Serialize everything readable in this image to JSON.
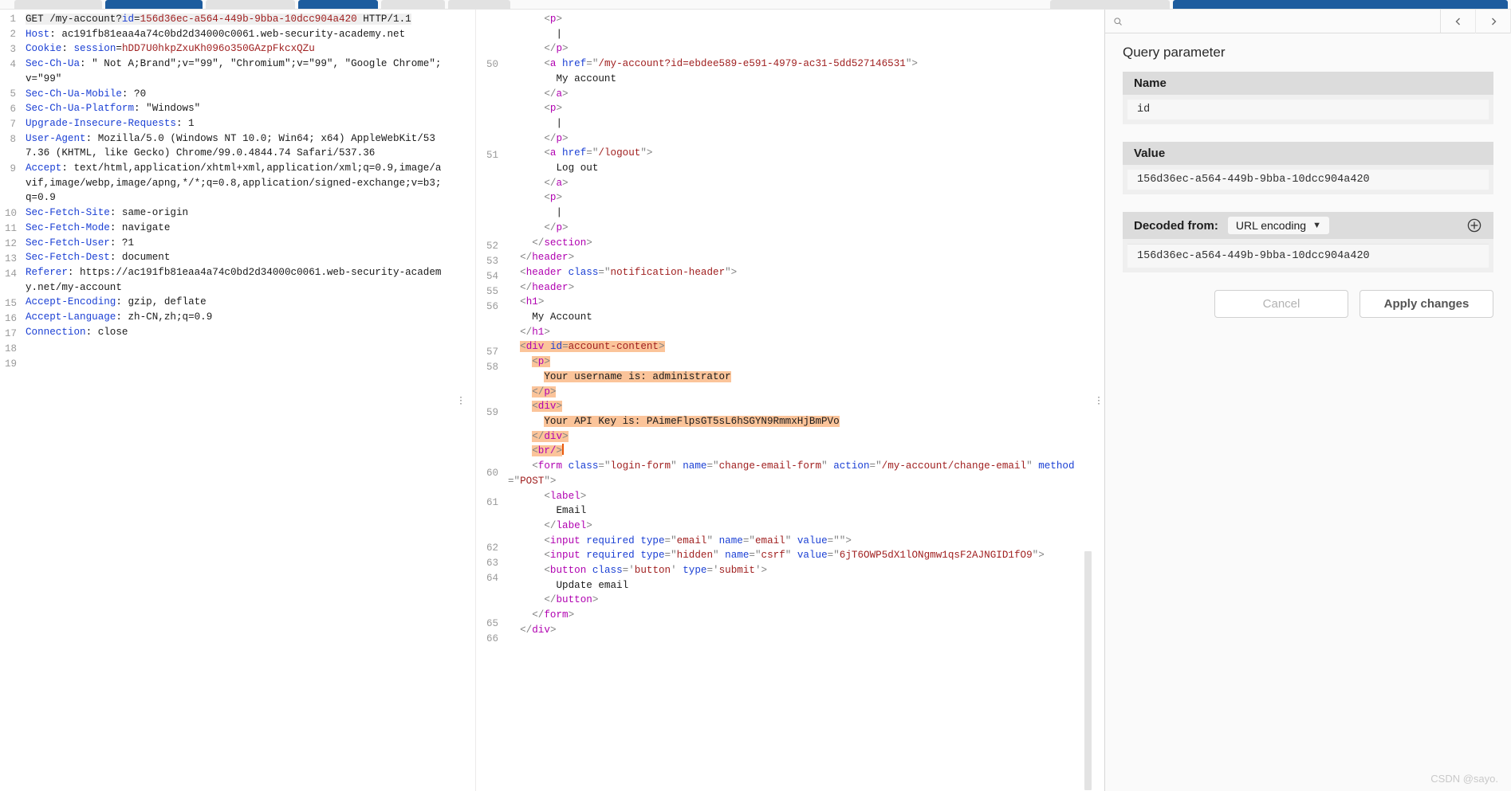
{
  "app": {
    "name": "burp-suite-repeater",
    "watermark": "CSDN @sayo."
  },
  "tabstrip": {
    "tabs": [
      {
        "name": "tab-dashboard",
        "selected": false
      },
      {
        "name": "tab-target",
        "selected": true
      },
      {
        "name": "tab-proxy",
        "selected": false
      },
      {
        "name": "tab-intruder",
        "selected": true
      },
      {
        "name": "tab-repeater",
        "selected": false
      },
      {
        "name": "tab-sequencer",
        "selected": false
      }
    ],
    "right_tabs": [
      {
        "name": "tab-request",
        "selected": false
      },
      {
        "name": "tab-response",
        "selected": true
      }
    ]
  },
  "request": {
    "pane_name": "request-editor",
    "lines": [
      {
        "n": "1",
        "html": "<span class='hl-soft'><span class='k-txt'>GET /my-account?</span><span class='k-attr'>id</span><span class='k-txt'>=</span><span class='k-red'>156d36ec-a564-449b-9bba-10dcc904a420</span><span class='k-txt'> HTTP/1.1</span></span>"
      },
      {
        "n": "2",
        "html": "<span class='k-hdr'>Host</span><span class='k-txt'>: ac191fb81eaa4a74c0bd2d34000c0061.web-security-academy.net</span>"
      },
      {
        "n": "3",
        "html": "<span class='k-hdr'>Cookie</span><span class='k-txt'>: </span><span class='k-hdr'>session</span><span class='k-txt'>=</span><span class='k-red'>hDD7U0hkpZxuKh096o350GAzpFkcxQZu</span>"
      },
      {
        "n": "4",
        "html": "<span class='k-hdr'>Sec-Ch-Ua</span><span class='k-txt'>: \" Not A;Brand\";v=\"99\", \"Chromium\";v=\"99\", \"Google Chrome\";v=\"99\"</span>"
      },
      {
        "n": "5",
        "html": "<span class='k-hdr'>Sec-Ch-Ua-Mobile</span><span class='k-txt'>: ?0</span>"
      },
      {
        "n": "6",
        "html": "<span class='k-hdr'>Sec-Ch-Ua-Platform</span><span class='k-txt'>: \"Windows\"</span>"
      },
      {
        "n": "7",
        "html": "<span class='k-hdr'>Upgrade-Insecure-Requests</span><span class='k-txt'>: 1</span>"
      },
      {
        "n": "8",
        "html": "<span class='k-hdr'>User-Agent</span><span class='k-txt'>: Mozilla/5.0 (Windows NT 10.0; Win64; x64) AppleWebKit/537.36 (KHTML, like Gecko) Chrome/99.0.4844.74 Safari/537.36</span>"
      },
      {
        "n": "9",
        "html": "<span class='k-hdr'>Accept</span><span class='k-txt'>: text/html,application/xhtml+xml,application/xml;q=0.9,image/avif,image/webp,image/apng,*/*;q=0.8,application/signed-exchange;v=b3;q=0.9</span>"
      },
      {
        "n": "10",
        "html": "<span class='k-hdr'>Sec-Fetch-Site</span><span class='k-txt'>: same-origin</span>"
      },
      {
        "n": "11",
        "html": "<span class='k-hdr'>Sec-Fetch-Mode</span><span class='k-txt'>: navigate</span>"
      },
      {
        "n": "12",
        "html": "<span class='k-hdr'>Sec-Fetch-User</span><span class='k-txt'>: ?1</span>"
      },
      {
        "n": "13",
        "html": "<span class='k-hdr'>Sec-Fetch-Dest</span><span class='k-txt'>: document</span>"
      },
      {
        "n": "14",
        "html": "<span class='k-hdr'>Referer</span><span class='k-txt'>: https://ac191fb81eaa4a74c0bd2d34000c0061.web-security-academy.net/my-account</span>"
      },
      {
        "n": "15",
        "html": "<span class='k-hdr'>Accept-Encoding</span><span class='k-txt'>: gzip, deflate</span>"
      },
      {
        "n": "16",
        "html": "<span class='k-hdr'>Accept-Language</span><span class='k-txt'>: zh-CN,zh;q=0.9</span>"
      },
      {
        "n": "17",
        "html": "<span class='k-hdr'>Connection</span><span class='k-txt'>: close</span>"
      },
      {
        "n": "18",
        "html": ""
      },
      {
        "n": "19",
        "html": ""
      }
    ]
  },
  "response": {
    "pane_name": "response-editor",
    "lines": [
      {
        "n": "",
        "html": "      <span class='k-punc'>&lt;</span><span class='k-tag'>p</span><span class='k-punc'>&gt;</span>"
      },
      {
        "n": "",
        "html": "        <span class='k-txt'>|</span>"
      },
      {
        "n": "",
        "html": "      <span class='k-punc'>&lt;/</span><span class='k-tag'>p</span><span class='k-punc'>&gt;</span>"
      },
      {
        "n": "50",
        "html": "      <span class='k-punc'>&lt;</span><span class='k-tag'>a</span> <span class='k-attr'>href</span><span class='k-punc'>=\"</span><span class='k-red'>/my-account?id=ebdee589-e591-4979-ac31-5dd527146531</span><span class='k-punc'>\"&gt;</span>"
      },
      {
        "n": "",
        "html": "        <span class='k-txt'>My account</span>"
      },
      {
        "n": "",
        "html": "      <span class='k-punc'>&lt;/</span><span class='k-tag'>a</span><span class='k-punc'>&gt;</span>"
      },
      {
        "n": "",
        "html": "      <span class='k-punc'>&lt;</span><span class='k-tag'>p</span><span class='k-punc'>&gt;</span>"
      },
      {
        "n": "",
        "html": "        <span class='k-txt'>|</span>"
      },
      {
        "n": "",
        "html": "      <span class='k-punc'>&lt;/</span><span class='k-tag'>p</span><span class='k-punc'>&gt;</span>"
      },
      {
        "n": "51",
        "html": "      <span class='k-punc'>&lt;</span><span class='k-tag'>a</span> <span class='k-attr'>href</span><span class='k-punc'>=\"</span><span class='k-red'>/logout</span><span class='k-punc'>\"&gt;</span>"
      },
      {
        "n": "",
        "html": "        <span class='k-txt'>Log out</span>"
      },
      {
        "n": "",
        "html": "      <span class='k-punc'>&lt;/</span><span class='k-tag'>a</span><span class='k-punc'>&gt;</span>"
      },
      {
        "n": "",
        "html": "      <span class='k-punc'>&lt;</span><span class='k-tag'>p</span><span class='k-punc'>&gt;</span>"
      },
      {
        "n": "",
        "html": "        <span class='k-txt'>|</span>"
      },
      {
        "n": "",
        "html": "      <span class='k-punc'>&lt;/</span><span class='k-tag'>p</span><span class='k-punc'>&gt;</span>"
      },
      {
        "n": "52",
        "html": "    <span class='k-punc'>&lt;/</span><span class='k-tag'>section</span><span class='k-punc'>&gt;</span>"
      },
      {
        "n": "53",
        "html": "  <span class='k-punc'>&lt;/</span><span class='k-tag'>header</span><span class='k-punc'>&gt;</span>"
      },
      {
        "n": "54",
        "html": "  <span class='k-punc'>&lt;</span><span class='k-tag'>header</span> <span class='k-attr'>class</span><span class='k-punc'>=\"</span><span class='k-red'>notification-header</span><span class='k-punc'>\"&gt;</span>"
      },
      {
        "n": "55",
        "html": "  <span class='k-punc'>&lt;/</span><span class='k-tag'>header</span><span class='k-punc'>&gt;</span>"
      },
      {
        "n": "56",
        "html": "  <span class='k-punc'>&lt;</span><span class='k-tag'>h1</span><span class='k-punc'>&gt;</span>"
      },
      {
        "n": "",
        "html": "    <span class='k-txt'>My Account</span>"
      },
      {
        "n": "",
        "html": "  <span class='k-punc'>&lt;/</span><span class='k-tag'>h1</span><span class='k-punc'>&gt;</span>"
      },
      {
        "n": "57",
        "html": "  <span class='hl'><span class='k-punc'>&lt;</span><span class='k-tag'>div</span> <span class='k-attr'>id</span><span class='k-punc'>=</span><span class='k-red'>account-content</span><span class='k-punc'>&gt;</span></span>"
      },
      {
        "n": "58",
        "html": "    <span class='hl'><span class='k-punc'>&lt;</span><span class='k-tag'>p</span><span class='k-punc'>&gt;</span></span>"
      },
      {
        "n": "",
        "html": "      <span class='hl'><span class='k-txt'>Your username is: administrator</span></span>"
      },
      {
        "n": "",
        "html": "    <span class='hl'><span class='k-punc'>&lt;/</span><span class='k-tag'>p</span><span class='k-punc'>&gt;</span></span>"
      },
      {
        "n": "59",
        "html": "    <span class='hl'><span class='k-punc'>&lt;</span><span class='k-tag'>div</span><span class='k-punc'>&gt;</span></span>"
      },
      {
        "n": "",
        "html": "      <span class='hl'><span class='k-txt'>Your API Key is: PAimeFlpsGT5sL6hSGYN9RmmxHjBmPVo</span></span>"
      },
      {
        "n": "",
        "html": "    <span class='hl'><span class='k-punc'>&lt;/</span><span class='k-tag'>div</span><span class='k-punc'>&gt;</span></span>"
      },
      {
        "n": "",
        "html": "    <span class='hl'><span class='k-punc'>&lt;</span><span class='k-tag'>br/</span><span class='k-punc'>&gt;</span></span><span class='caret'></span>"
      },
      {
        "n": "60",
        "html": "    <span class='k-punc'>&lt;</span><span class='k-tag'>form</span> <span class='k-attr'>class</span><span class='k-punc'>=\"</span><span class='k-red'>login-form</span><span class='k-punc'>\"</span> <span class='k-attr'>name</span><span class='k-punc'>=\"</span><span class='k-red'>change-email-form</span><span class='k-punc'>\"</span> <span class='k-attr'>action</span><span class='k-punc'>=\"</span><span class='k-red'>/my-account/change-email</span><span class='k-punc'>\"</span> <span class='k-attr'>method</span><span class='k-punc'>=\"</span><span class='k-red'>POST</span><span class='k-punc'>\"&gt;</span>"
      },
      {
        "n": "61",
        "html": "      <span class='k-punc'>&lt;</span><span class='k-tag'>label</span><span class='k-punc'>&gt;</span>"
      },
      {
        "n": "",
        "html": "        <span class='k-txt'>Email</span>"
      },
      {
        "n": "",
        "html": "      <span class='k-punc'>&lt;/</span><span class='k-tag'>label</span><span class='k-punc'>&gt;</span>"
      },
      {
        "n": "62",
        "html": "      <span class='k-punc'>&lt;</span><span class='k-tag'>input</span> <span class='k-attr'>required</span> <span class='k-attr'>type</span><span class='k-punc'>=\"</span><span class='k-red'>email</span><span class='k-punc'>\"</span> <span class='k-attr'>name</span><span class='k-punc'>=\"</span><span class='k-red'>email</span><span class='k-punc'>\"</span> <span class='k-attr'>value</span><span class='k-punc'>=\"\"&gt;</span>"
      },
      {
        "n": "63",
        "html": "      <span class='k-punc'>&lt;</span><span class='k-tag'>input</span> <span class='k-attr'>required</span> <span class='k-attr'>type</span><span class='k-punc'>=\"</span><span class='k-red'>hidden</span><span class='k-punc'>\"</span> <span class='k-attr'>name</span><span class='k-punc'>=\"</span><span class='k-red'>csrf</span><span class='k-punc'>\"</span> <span class='k-attr'>value</span><span class='k-punc'>=\"</span><span class='k-red'>6jT6OWP5dX1lONgmw1qsF2AJNGID1fO9</span><span class='k-punc'>\"&gt;</span>"
      },
      {
        "n": "64",
        "html": "      <span class='k-punc'>&lt;</span><span class='k-tag'>button</span> <span class='k-attr'>class</span><span class='k-punc'>='</span><span class='k-red'>button</span><span class='k-punc'>'</span> <span class='k-attr'>type</span><span class='k-punc'>='</span><span class='k-red'>submit</span><span class='k-punc'>'&gt;</span>"
      },
      {
        "n": "",
        "html": "        <span class='k-txt'>Update email</span>"
      },
      {
        "n": "",
        "html": "      <span class='k-punc'>&lt;/</span><span class='k-tag'>button</span><span class='k-punc'>&gt;</span>"
      },
      {
        "n": "65",
        "html": "    <span class='k-punc'>&lt;/</span><span class='k-tag'>form</span><span class='k-punc'>&gt;</span>"
      },
      {
        "n": "66",
        "html": "  <span class='k-punc'>&lt;/</span><span class='k-tag'>div</span><span class='k-punc'>&gt;</span>"
      }
    ]
  },
  "inspector": {
    "search_placeholder": "Search",
    "title": "Query parameter",
    "name_label": "Name",
    "name_value": "id",
    "value_label": "Value",
    "value_value": "156d36ec-a564-449b-9bba-10dcc904a420",
    "decoded_label": "Decoded from:",
    "decoding_selected": "URL encoding",
    "decoded_value": "156d36ec-a564-449b-9bba-10dcc904a420",
    "cancel_label": "Cancel",
    "apply_label": "Apply changes"
  }
}
